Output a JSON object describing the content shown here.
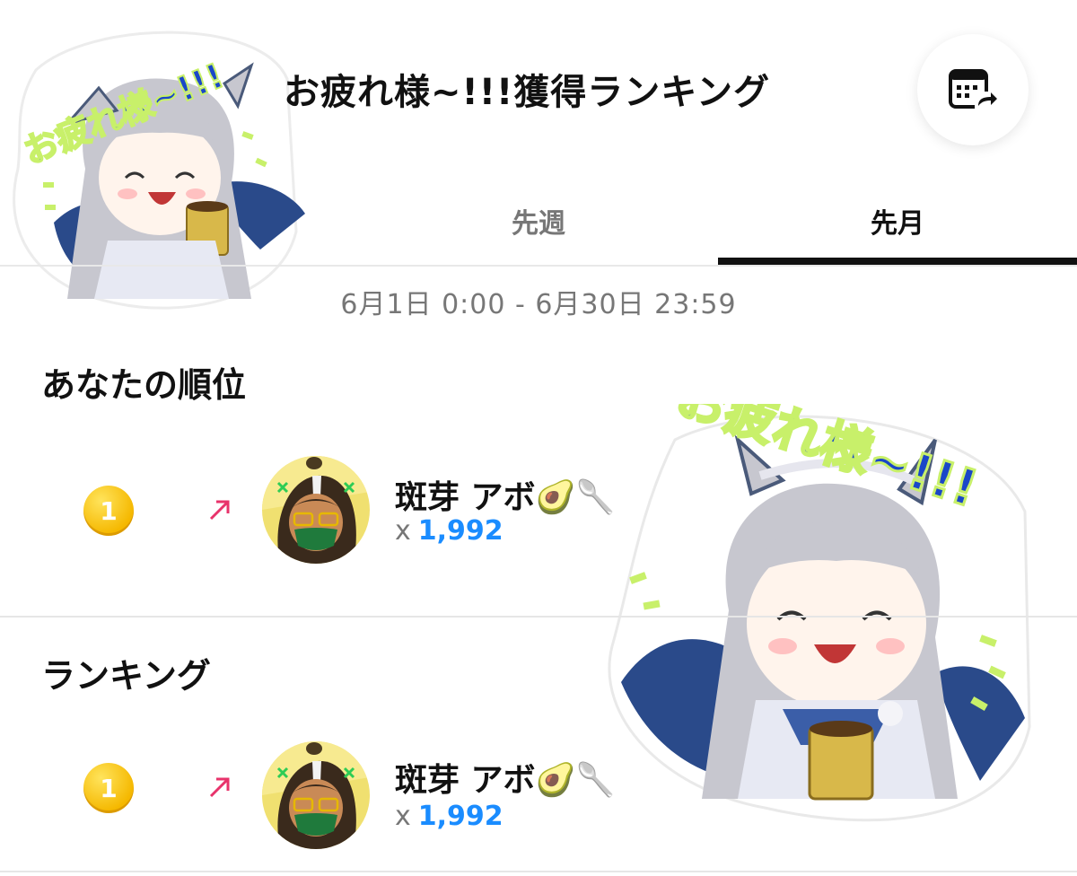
{
  "header": {
    "title": "お疲れ様~!!!獲得ランキング",
    "calendar_icon": "calendar-share-icon"
  },
  "tabs": [
    {
      "label": "先週",
      "active": false
    },
    {
      "label": "先月",
      "active": true
    }
  ],
  "date_range": "6月1日 0:00 - 6月30日 23:59",
  "my_rank": {
    "section_title": "あなたの順位",
    "entry": {
      "rank": "1",
      "trend": "up",
      "name": "斑芽 アボ🥑🥄",
      "count_prefix": "x",
      "count": "1,992"
    }
  },
  "ranking": {
    "section_title": "ランキング",
    "entries": [
      {
        "rank": "1",
        "trend": "up",
        "name": "斑芽 アボ🥑🥄",
        "count_prefix": "x",
        "count": "1,992"
      }
    ]
  },
  "stickers": {
    "text": "お疲れ様~!!!"
  },
  "colors": {
    "accent_count": "#1a8cff",
    "rank_gold": "#f5b800",
    "trend_up": "#e8336b",
    "tab_active": "#111111",
    "tab_inactive": "#777777"
  }
}
